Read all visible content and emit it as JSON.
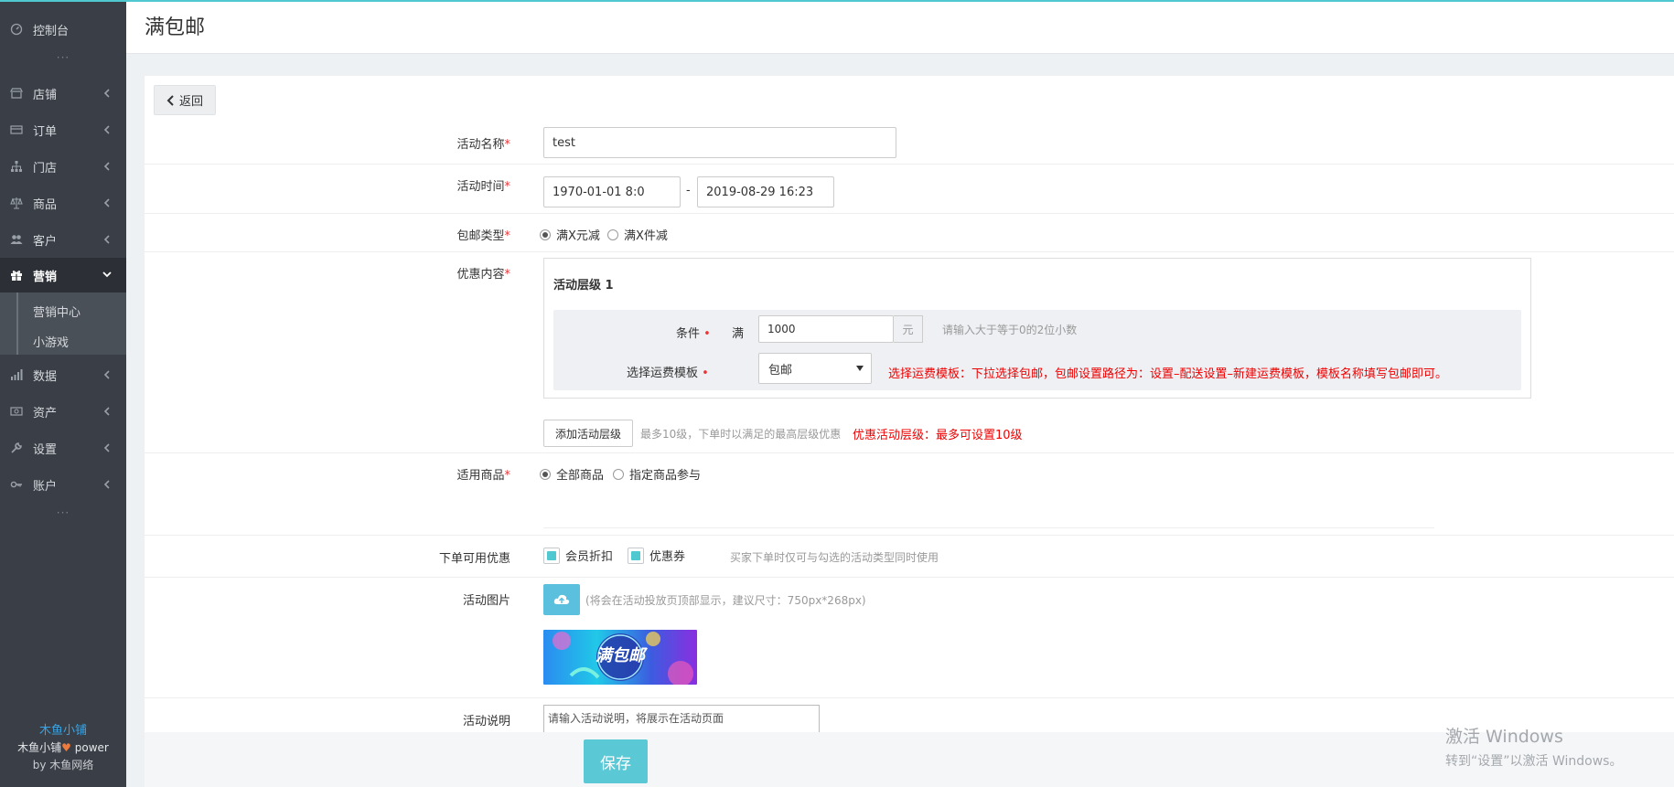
{
  "app": {
    "accent": "#4fc8cf",
    "sidebar_bg": "#3a3f47"
  },
  "sidebar": {
    "items": [
      {
        "label": "控制台",
        "icon": "dashboard-icon"
      },
      {
        "label": "店铺",
        "icon": "store-icon"
      },
      {
        "label": "订单",
        "icon": "order-icon"
      },
      {
        "label": "门店",
        "icon": "sitemap-icon"
      },
      {
        "label": "商品",
        "icon": "scale-icon"
      },
      {
        "label": "客户",
        "icon": "users-icon"
      },
      {
        "label": "营销",
        "icon": "gift-icon"
      },
      {
        "label": "数据",
        "icon": "bar-chart-icon"
      },
      {
        "label": "资产",
        "icon": "money-icon"
      },
      {
        "label": "设置",
        "icon": "wrench-icon"
      },
      {
        "label": "账户",
        "icon": "key-icon"
      }
    ],
    "sub_items": [
      {
        "label": "营销中心"
      },
      {
        "label": "小游戏"
      }
    ],
    "dots": "···",
    "footer": {
      "brand": "木鱼小铺",
      "power_prefix": "木鱼小铺",
      "power_suffix": " power",
      "by": "by 木鱼网络"
    }
  },
  "header": {
    "title": "满包邮"
  },
  "back_button": {
    "label": "返回"
  },
  "form": {
    "name": {
      "label": "活动名称",
      "value": "test"
    },
    "time": {
      "label": "活动时间",
      "start": "1970-01-01 8:0",
      "separator": "-",
      "end": "2019-08-29 16:23"
    },
    "type": {
      "label": "包邮类型",
      "options": [
        "满X元减",
        "满X件减"
      ],
      "selected": "满X元减"
    },
    "discount": {
      "label": "优惠内容",
      "tier_title": "活动层级 1",
      "condition_label": "条件",
      "condition_prefix": "满",
      "condition_value": "1000",
      "condition_unit": "元",
      "condition_hint": "请输入大于等于0的2位小数",
      "template_label": "选择运费模板",
      "template_value": "包邮",
      "template_note": "选择运费模板：下拉选择包邮，包邮设置路径为：设置–配送设置–新建运费模板，模板名称填写包邮即可。",
      "add_tier_label": "添加活动层级",
      "add_tier_hint": "最多10级，下单时以满足的最高层级优惠",
      "tier_note": "优惠活动层级：最多可设置10级"
    },
    "goods": {
      "label": "适用商品",
      "options": [
        "全部商品",
        "指定商品参与"
      ],
      "selected": "全部商品"
    },
    "stackable": {
      "label": "下单可用优惠",
      "options": [
        "会员折扣",
        "优惠券"
      ],
      "hint": "买家下单时仅可与勾选的活动类型同时使用"
    },
    "image": {
      "label": "活动图片",
      "hint": "(将会在活动投放页顶部显示，建议尺寸：750px*268px)",
      "banner_text": "满包邮"
    },
    "desc": {
      "label": "活动说明",
      "placeholder": "请输入活动说明，将展示在活动页面"
    },
    "save_label": "保存"
  },
  "watermark": {
    "line1": "激活 Windows",
    "line2": "转到“设置”以激活 Windows。"
  }
}
